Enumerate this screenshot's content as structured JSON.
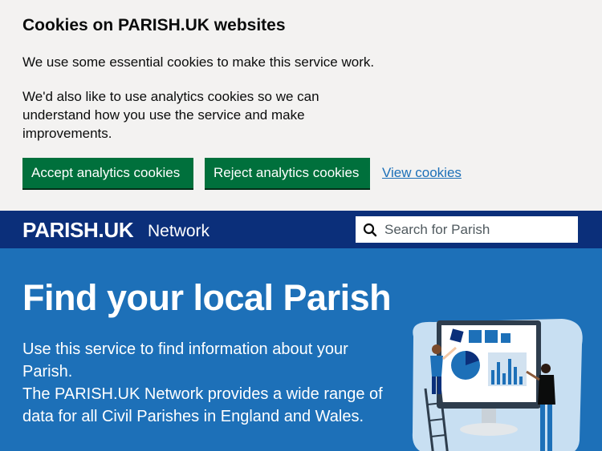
{
  "cookie_banner": {
    "title": "Cookies on PARISH.UK websites",
    "paragraph_1": "We use some essential cookies to make this service work.",
    "paragraph_2": "We'd also like to use analytics cookies so we can understand how you use the service and make improvements.",
    "accept_label": "Accept analytics cookies",
    "reject_label": "Reject analytics cookies",
    "view_label": "View cookies"
  },
  "header": {
    "brand": "PARISH.UK",
    "brand_sub": "Network",
    "search_placeholder": "Search for Parish",
    "search_icon": "search-icon"
  },
  "hero": {
    "title": "Find your local Parish",
    "line_1": "Use this service to find information about your Parish.",
    "line_2": "The PARISH.UK Network provides a wide range of data for all Civil Parishes in England and Wales."
  },
  "colors": {
    "banner_bg": "#f3f2f1",
    "button_green": "#00703c",
    "header_bg": "#0b2f7a",
    "hero_bg": "#1d70b8",
    "link": "#1d70b8"
  }
}
